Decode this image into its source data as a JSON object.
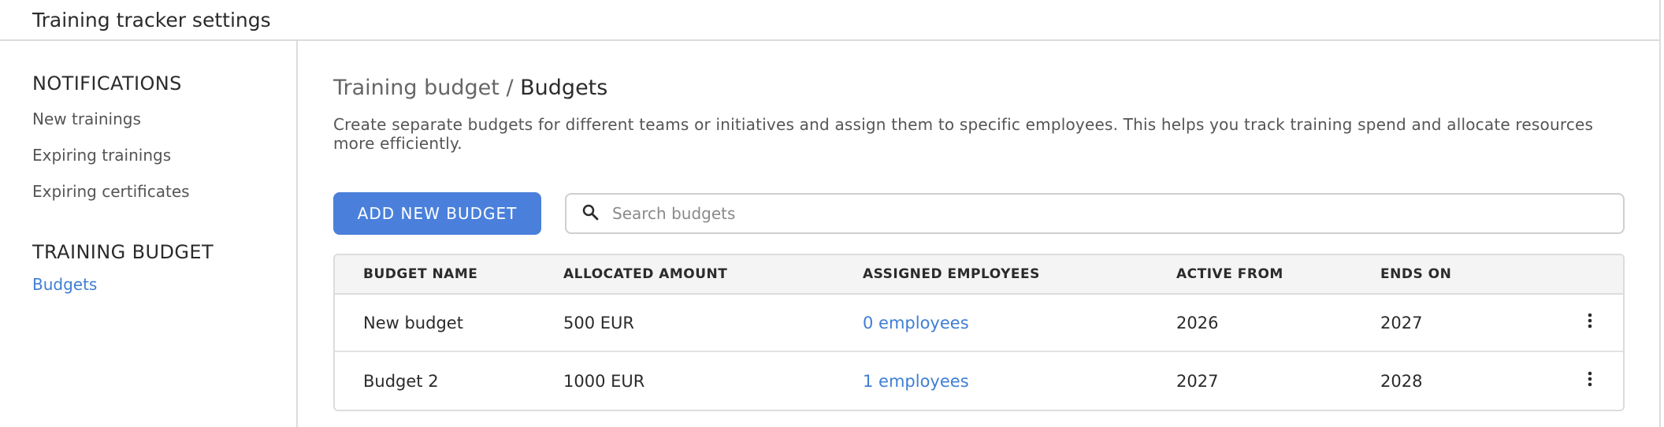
{
  "app": {
    "title": "Training tracker settings"
  },
  "sidebar": {
    "sections": [
      {
        "title": "NOTIFICATIONS",
        "items": [
          {
            "label": "New trainings"
          },
          {
            "label": "Expiring trainings"
          },
          {
            "label": "Expiring certificates"
          }
        ]
      },
      {
        "title": "TRAINING BUDGET",
        "items": [
          {
            "label": "Budgets",
            "active": true
          }
        ]
      }
    ]
  },
  "main": {
    "breadcrumb": {
      "parent": "Training budget",
      "separator": "/",
      "current": "Budgets"
    },
    "description": "Create separate budgets for different teams or initiatives and assign them to specific employees. This helps you track training spend and allocate resources more efficiently.",
    "add_button_label": "ADD NEW BUDGET",
    "search": {
      "placeholder": "Search budgets",
      "value": ""
    },
    "table": {
      "headers": [
        "BUDGET NAME",
        "ALLOCATED AMOUNT",
        "ASSIGNED EMPLOYEES",
        "ACTIVE FROM",
        "ENDS ON"
      ],
      "rows": [
        {
          "name": "New budget",
          "amount": "500 EUR",
          "employees": "0 employees",
          "active_from": "2026",
          "ends_on": "2027"
        },
        {
          "name": "Budget 2",
          "amount": "1000 EUR",
          "employees": "1 employees",
          "active_from": "2027",
          "ends_on": "2028"
        }
      ]
    }
  },
  "colors": {
    "accent": "#4a80db",
    "link": "#3f7ed4",
    "border": "#dcdcdc",
    "header_bg": "#f4f4f4"
  },
  "icons": {
    "search": "search-icon",
    "row_menu": "more-vertical-icon"
  }
}
